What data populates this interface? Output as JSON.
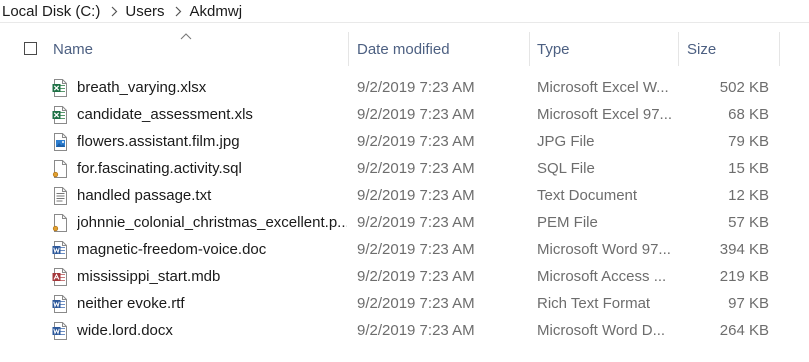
{
  "breadcrumb": {
    "items": [
      "Local Disk (C:)",
      "Users",
      "Akdmwj"
    ]
  },
  "columns": {
    "name": "Name",
    "date_modified": "Date modified",
    "type": "Type",
    "size": "Size"
  },
  "files": [
    {
      "name": "breath_varying.xlsx",
      "date": "9/2/2019 7:23 AM",
      "type": "Microsoft Excel W...",
      "size": "502 KB",
      "icon": "excel-file-icon"
    },
    {
      "name": "candidate_assessment.xls",
      "date": "9/2/2019 7:23 AM",
      "type": "Microsoft Excel 97...",
      "size": "68 KB",
      "icon": "excel-file-icon"
    },
    {
      "name": "flowers.assistant.film.jpg",
      "date": "9/2/2019 7:23 AM",
      "type": "JPG File",
      "size": "79 KB",
      "icon": "image-file-icon"
    },
    {
      "name": "for.fascinating.activity.sql",
      "date": "9/2/2019 7:23 AM",
      "type": "SQL File",
      "size": "15 KB",
      "icon": "generic-file-icon"
    },
    {
      "name": "handled passage.txt",
      "date": "9/2/2019 7:23 AM",
      "type": "Text Document",
      "size": "12 KB",
      "icon": "text-file-icon"
    },
    {
      "name": "johnnie_colonial_christmas_excellent.p...",
      "date": "9/2/2019 7:23 AM",
      "type": "PEM File",
      "size": "57 KB",
      "icon": "generic-file-icon"
    },
    {
      "name": "magnetic-freedom-voice.doc",
      "date": "9/2/2019 7:23 AM",
      "type": "Microsoft Word 97...",
      "size": "394 KB",
      "icon": "word-file-icon"
    },
    {
      "name": "mississippi_start.mdb",
      "date": "9/2/2019 7:23 AM",
      "type": "Microsoft Access ...",
      "size": "219 KB",
      "icon": "access-file-icon"
    },
    {
      "name": "neither evoke.rtf",
      "date": "9/2/2019 7:23 AM",
      "type": "Rich Text Format",
      "size": "97 KB",
      "icon": "word-file-icon"
    },
    {
      "name": "wide.lord.docx",
      "date": "9/2/2019 7:23 AM",
      "type": "Microsoft Word D...",
      "size": "264 KB",
      "icon": "word-file-icon"
    }
  ],
  "colors": {
    "header_text": "#4d6082",
    "excel": "#1e7145",
    "word": "#2b579a",
    "access": "#a4373a",
    "image": "#2f7fd0"
  }
}
